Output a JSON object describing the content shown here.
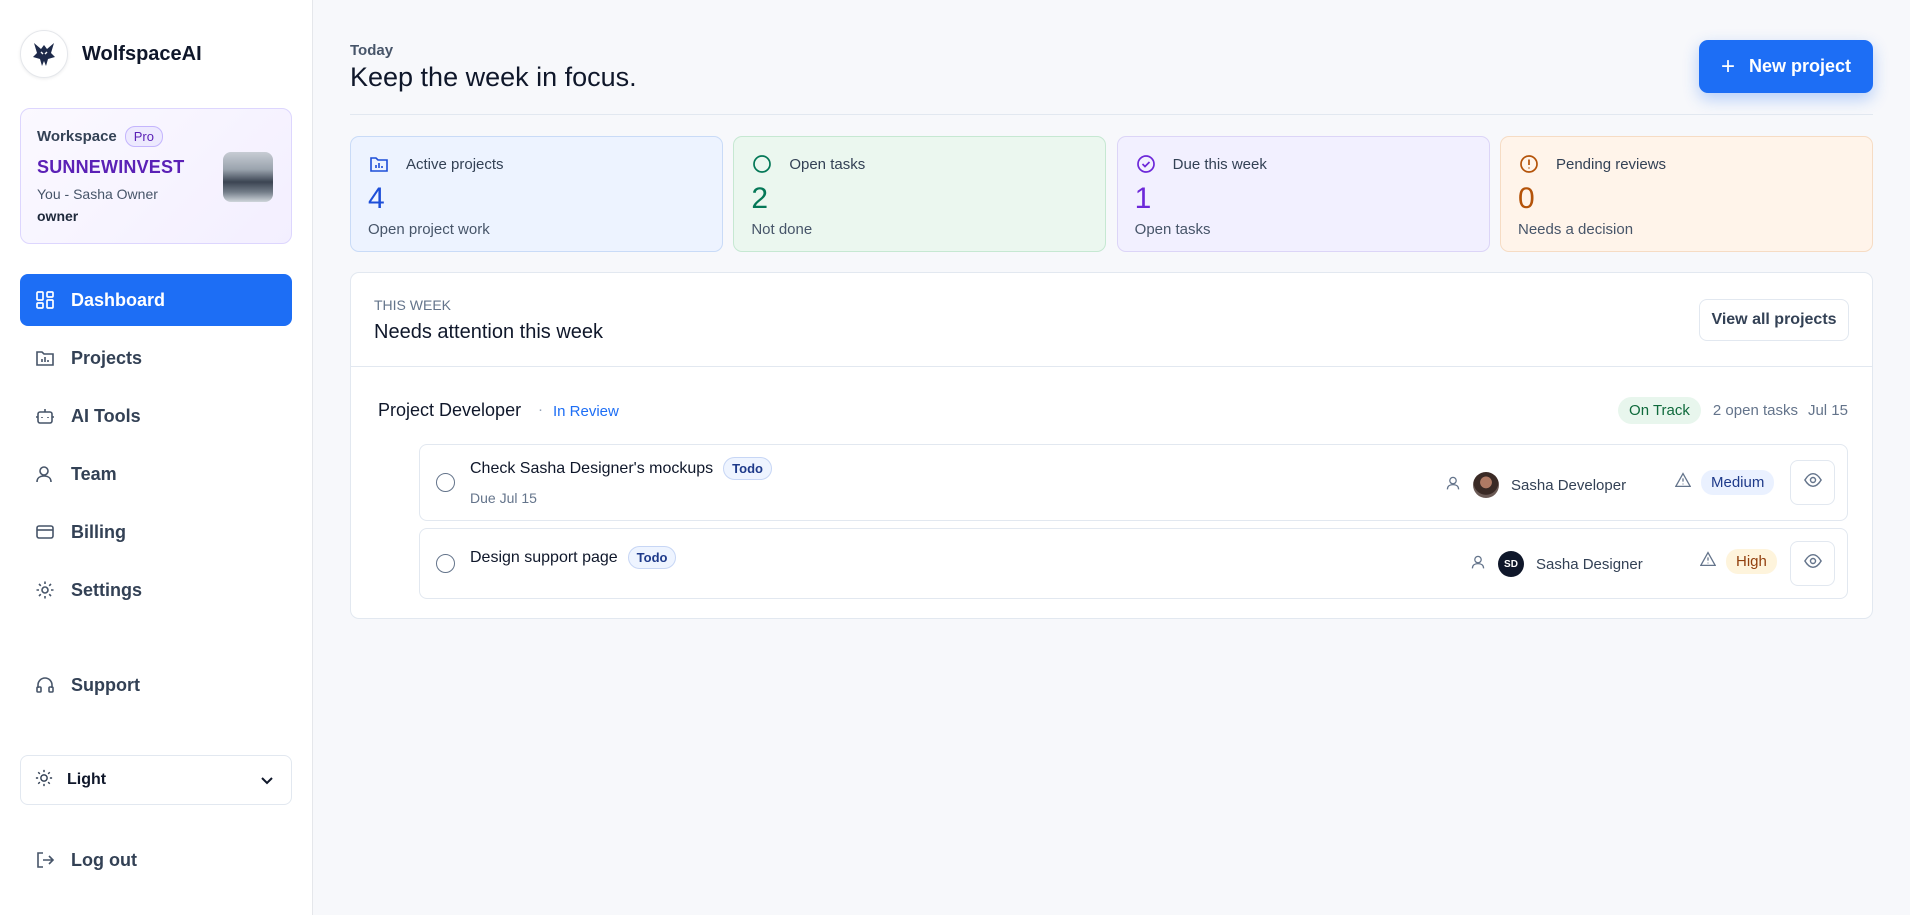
{
  "brand": {
    "name": "WolfspaceAI"
  },
  "workspace": {
    "label": "Workspace",
    "plan": "Pro",
    "name": "SUNNEWINVEST",
    "owner_line": "You - Sasha Owner",
    "role": "owner"
  },
  "nav": [
    {
      "label": "Dashboard",
      "icon": "dashboard-icon",
      "active": true
    },
    {
      "label": "Projects",
      "icon": "folder-icon",
      "active": false
    },
    {
      "label": "AI Tools",
      "icon": "robot-icon",
      "active": false
    },
    {
      "label": "Team",
      "icon": "user-icon",
      "active": false
    },
    {
      "label": "Billing",
      "icon": "credit-card-icon",
      "active": false
    },
    {
      "label": "Settings",
      "icon": "gear-icon",
      "active": false
    }
  ],
  "support": {
    "label": "Support",
    "icon": "headset-icon"
  },
  "theme": {
    "value": "Light",
    "icon": "sun-icon"
  },
  "logout": {
    "label": "Log out",
    "icon": "logout-icon"
  },
  "header": {
    "kicker": "Today",
    "title": "Keep the week in focus.",
    "new_button": "New project"
  },
  "stats": [
    {
      "title": "Active projects",
      "value": "4",
      "sub": "Open project work",
      "icon": "folder-chart-icon",
      "color": "#1d4ed8"
    },
    {
      "title": "Open tasks",
      "value": "2",
      "sub": "Not done",
      "icon": "circle-icon",
      "color": "#047857"
    },
    {
      "title": "Due this week",
      "value": "1",
      "sub": "Open tasks",
      "icon": "check-circle-icon",
      "color": "#6d28d9"
    },
    {
      "title": "Pending reviews",
      "value": "0",
      "sub": "Needs a decision",
      "icon": "alert-circle-icon",
      "color": "#b45309"
    }
  ],
  "attention": {
    "kicker": "THIS WEEK",
    "title": "Needs attention this week",
    "view_all": "View all projects",
    "project": {
      "name": "Project Developer",
      "separator": "·",
      "status": "In Review",
      "health": "On Track",
      "open_tasks": "2 open tasks",
      "due": "Jul 15"
    },
    "tasks": [
      {
        "title": "Check Sasha Designer's mockups",
        "tag": "Todo",
        "due": "Due Jul 15",
        "assignee": "Sasha Developer",
        "priority": "Medium"
      },
      {
        "title": "Design support page",
        "tag": "Todo",
        "due": "",
        "assignee": "Sasha Designer",
        "assignee_initials": "SD",
        "priority": "High"
      }
    ]
  },
  "colors": {
    "accent": "#1d6ef5",
    "workspace_name": "#5b21b6"
  }
}
